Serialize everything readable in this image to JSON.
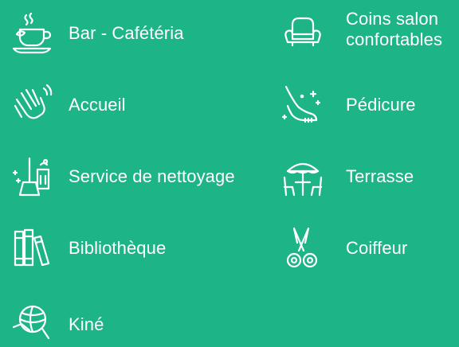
{
  "colors": {
    "background": "#1db488",
    "foreground": "#ffffff"
  },
  "services": [
    {
      "label": "Bar - Cafétéria",
      "icon": "coffee-cup-icon"
    },
    {
      "label": "Accueil",
      "icon": "waving-hand-icon"
    },
    {
      "label": "Service de nettoyage",
      "icon": "cleaning-broom-icon"
    },
    {
      "label": "Bibliothèque",
      "icon": "books-icon"
    },
    {
      "label": "Kiné",
      "icon": "exercise-ball-icon"
    },
    {
      "label": "Coins salon confortables",
      "icon": "armchair-icon"
    },
    {
      "label": "Pédicure",
      "icon": "foot-care-icon"
    },
    {
      "label": "Terrasse",
      "icon": "patio-umbrella-icon"
    },
    {
      "label": "Coiffeur",
      "icon": "scissors-icon"
    }
  ]
}
